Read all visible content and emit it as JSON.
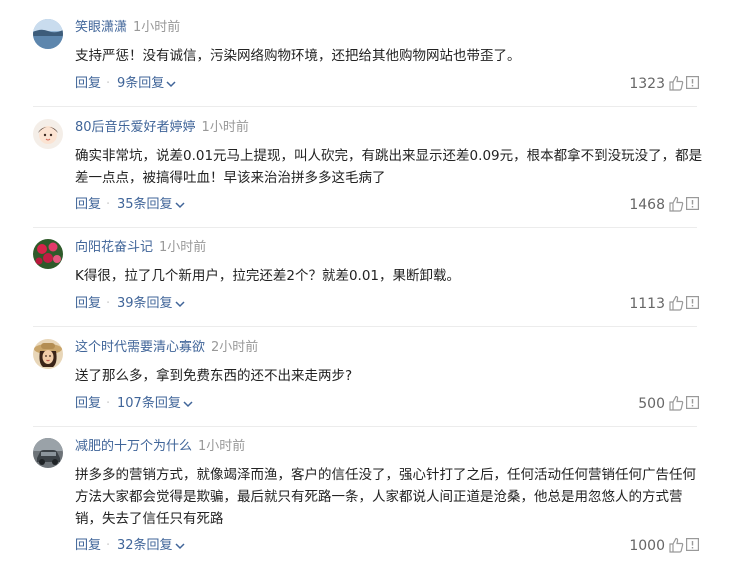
{
  "comments": [
    {
      "username": "笑眼潇潇",
      "time": "1小时前",
      "text": "支持严惩！没有诚信，污染网络购物环境，还把给其他购物网站也带歪了。",
      "reply_label": "回复",
      "replies_label": "9条回复",
      "likes": "1323",
      "avatar_icon": "avatar-lake-icon"
    },
    {
      "username": "80后音乐爱好者婷婷",
      "time": "1小时前",
      "text": "确实非常坑，说差0.01元马上提现，叫人砍完，有跳出来显示还差0.09元，根本都拿不到没玩没了，都是差一点点，被搞得吐血！早该来治治拼多多这毛病了",
      "reply_label": "回复",
      "replies_label": "35条回复",
      "likes": "1468",
      "avatar_icon": "avatar-cartoon-girl-icon"
    },
    {
      "username": "向阳花奋斗记",
      "time": "1小时前",
      "text": "K得很，拉了几个新用户，拉完还差2个？就差0.01，果断卸载。",
      "reply_label": "回复",
      "replies_label": "39条回复",
      "likes": "1113",
      "avatar_icon": "avatar-flowers-icon"
    },
    {
      "username": "这个时代需要清心寡欲",
      "time": "2小时前",
      "text": "送了那么多，拿到免费东西的还不出来走两步?",
      "reply_label": "回复",
      "replies_label": "107条回复",
      "likes": "500",
      "avatar_icon": "avatar-woman-hat-icon"
    },
    {
      "username": "减肥的十万个为什么",
      "time": "1小时前",
      "text": "拼多多的营销方式，就像竭泽而渔，客户的信任没了，强心针打了之后，任何活动任何营销任何广告任何方法大家都会觉得是欺骗，最后就只有死路一条，人家都说人间正道是沧桑，他总是用忽悠人的方式营销，失去了信任只有死路",
      "reply_label": "回复",
      "replies_label": "32条回复",
      "likes": "1000",
      "avatar_icon": "avatar-car-icon"
    }
  ],
  "colors": {
    "username": "#406599",
    "time": "#999999",
    "link": "#406599",
    "text": "#222222",
    "count": "#666666"
  }
}
